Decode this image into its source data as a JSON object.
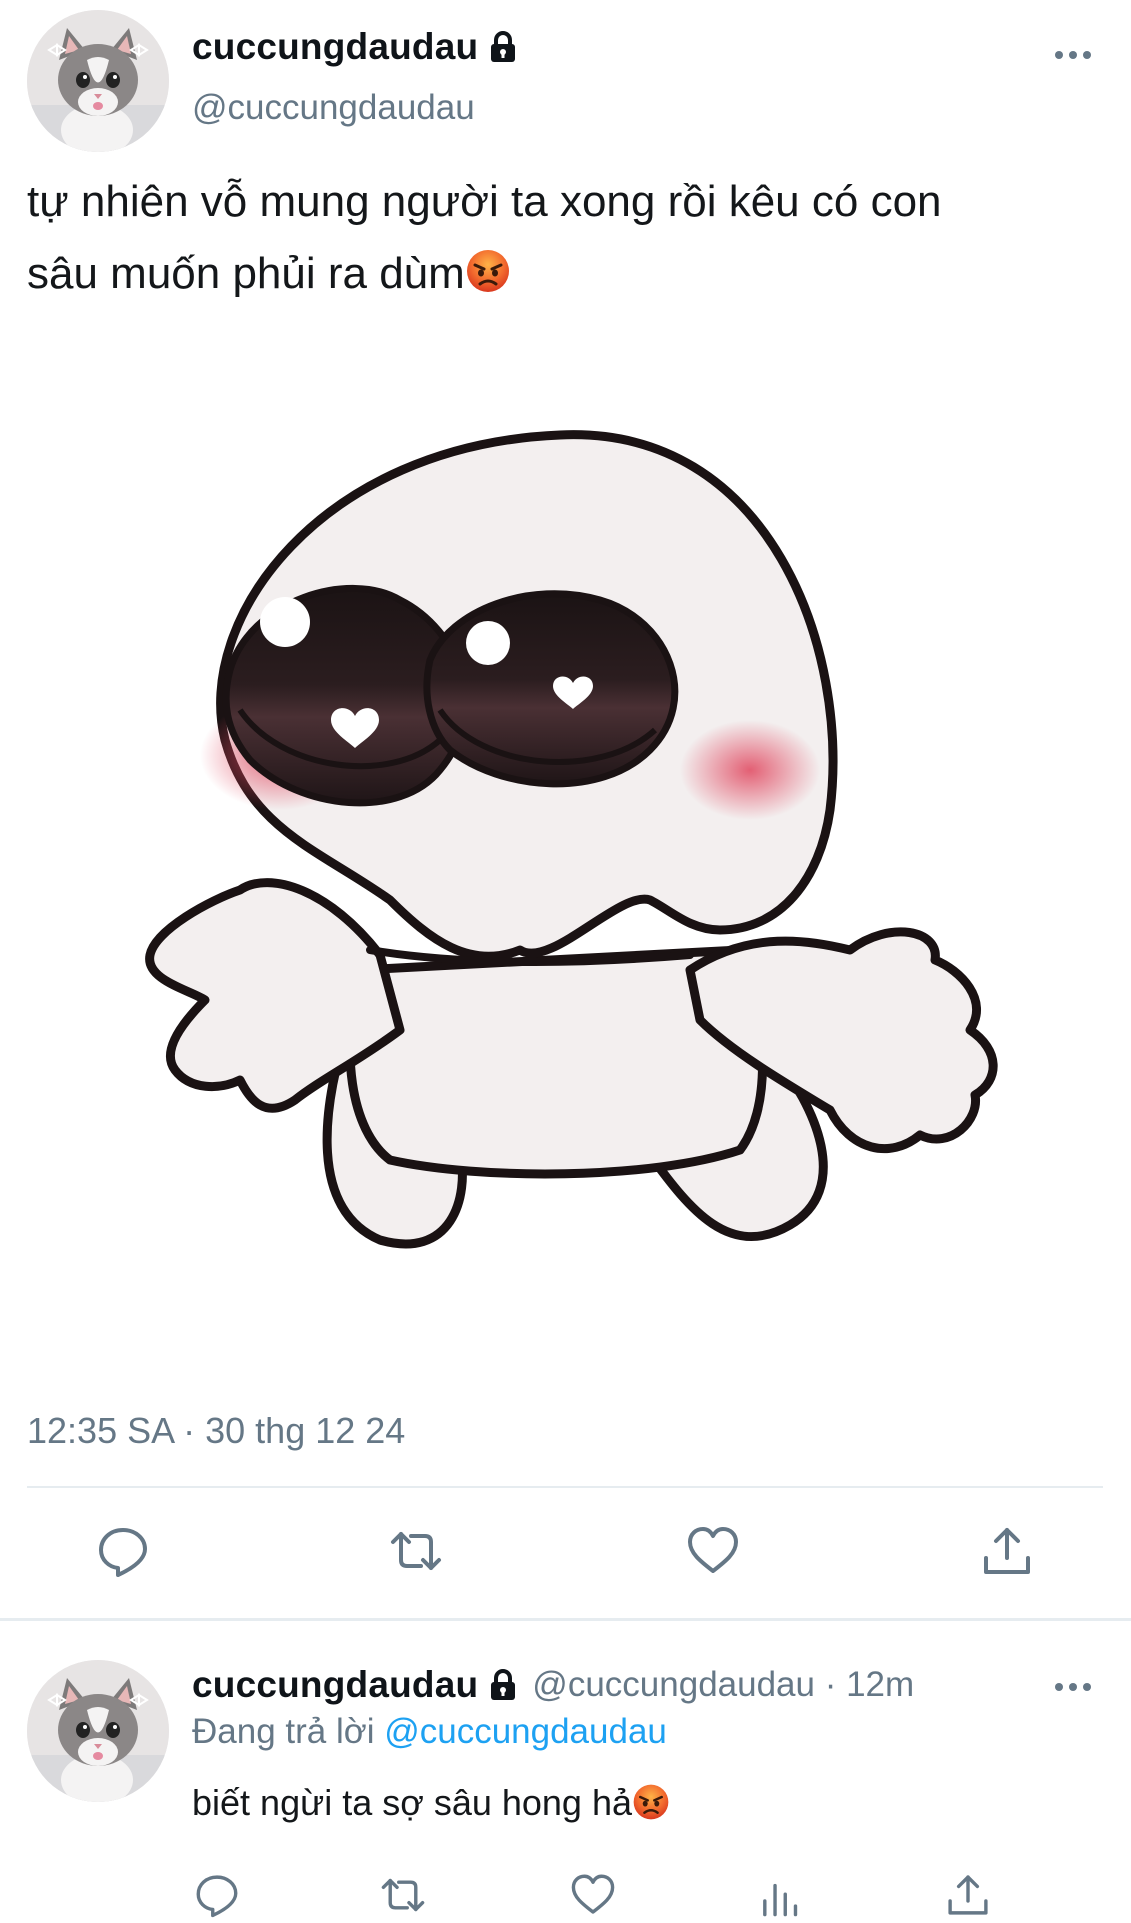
{
  "tweet": {
    "display_name": "cuccungdaudau",
    "handle": "@cuccungdaudau",
    "text": "tự nhiên vỗ mung người ta xong rồi kêu có con sâu muốn phủi ra dùm",
    "text_line1": "tự nhiên vỗ mung người ta xong rồi kêu có con",
    "text_line2": "sâu muốn phủi ra dùm",
    "emoji": "angry-face-emoji",
    "timestamp": "12:35 SA · 30 thg 12 24",
    "media": "cartoon blob character with big eyes and open arms",
    "actions": [
      "reply-icon",
      "retweet-icon",
      "like-icon",
      "share-icon"
    ]
  },
  "reply": {
    "display_name": "cuccungdaudau",
    "handle_time": "@cuccungdaudau · 12m",
    "replying_label": "Đang trả lời",
    "replying_to": "@cuccungdaudau",
    "text": "biết ngừi ta sợ sâu hong hả",
    "actions": [
      "reply-icon",
      "retweet-icon",
      "like-icon",
      "analytics-icon",
      "share-icon"
    ]
  },
  "colors": {
    "text": "#14171a",
    "muted": "#657786",
    "link": "#1da1f2",
    "divider": "#e6ecf0"
  }
}
